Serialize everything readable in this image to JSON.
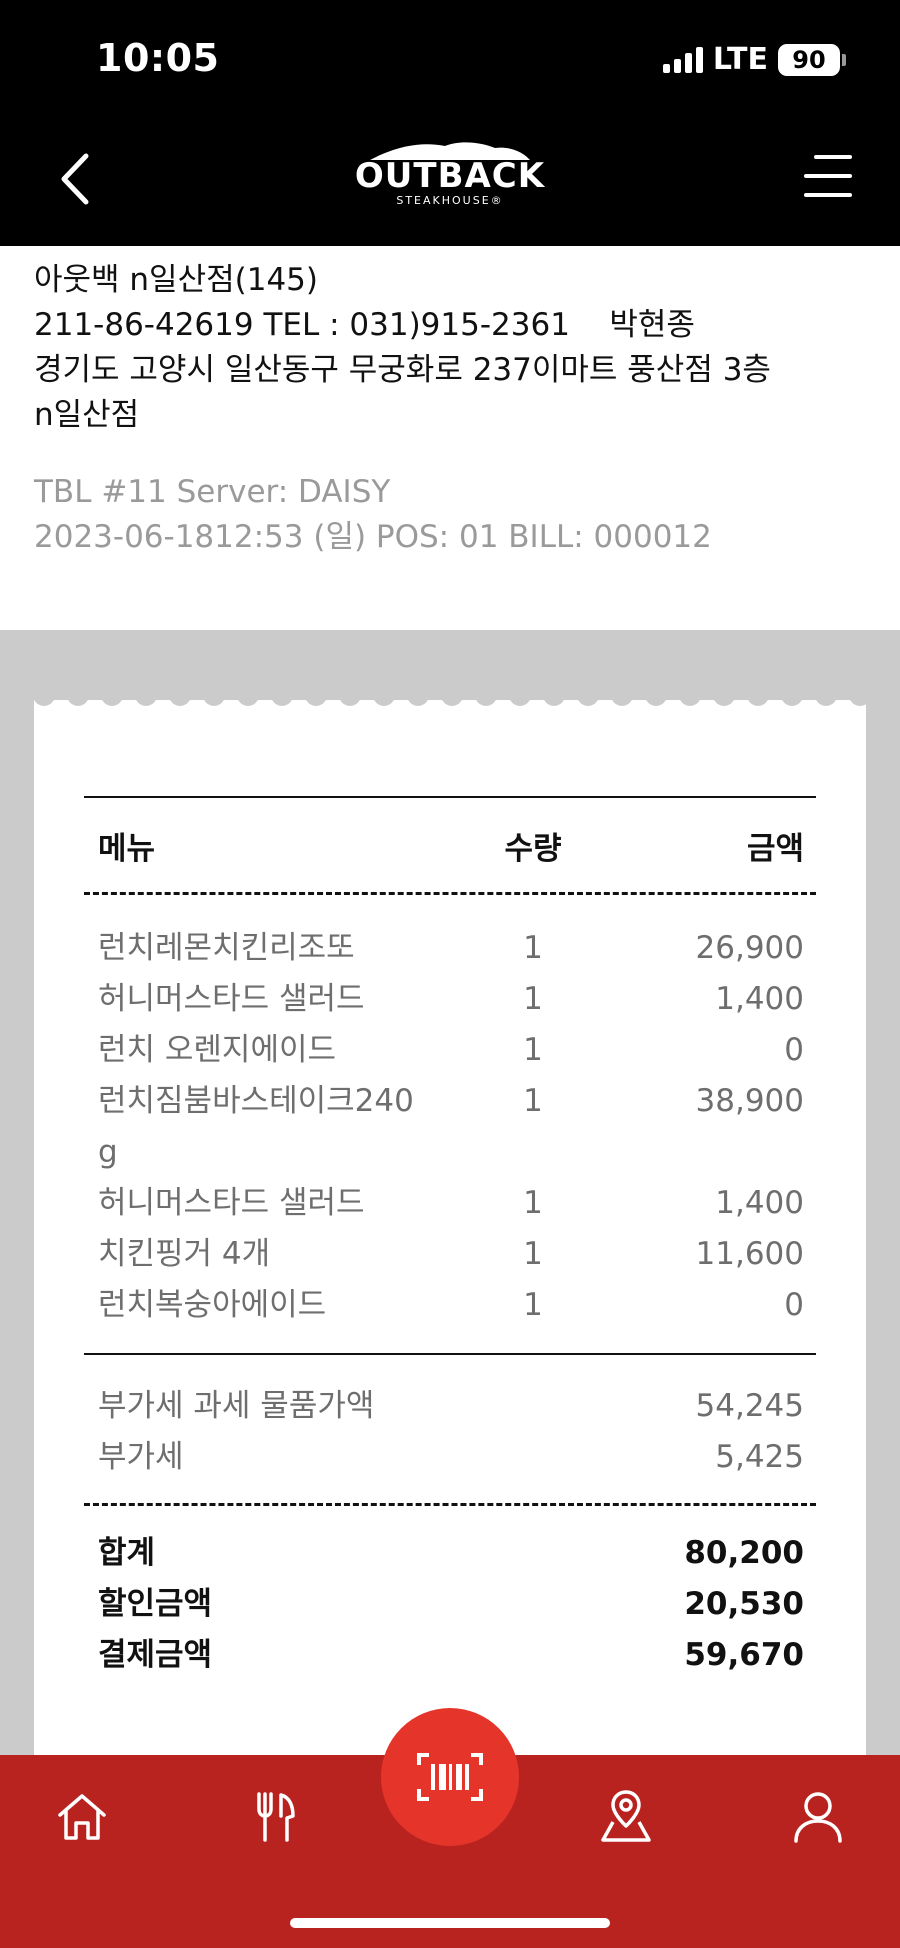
{
  "status_bar": {
    "time": "10:05",
    "network": "LTE",
    "battery": "90"
  },
  "header": {
    "logo_text": "OUTBACK",
    "logo_subtext": "STEAKHOUSE®",
    "back_icon": "chevron-left-icon",
    "menu_icon": "hamburger-menu-icon"
  },
  "store": {
    "name": "아웃백 n일산점(145)",
    "reg_line": "211-86-42619 TEL : 031)915-2361    박현종",
    "address_line1": "경기도 고양시 일산동구 무궁화로 237이마트 풍산점 3층",
    "address_line2": "n일산점"
  },
  "order_meta": {
    "table_line": "TBL #11 Server: DAISY",
    "datetime_line": "2023-06-1812:53 (일) POS: 01 BILL: 000012"
  },
  "receipt": {
    "columns": {
      "menu": "메뉴",
      "qty": "수량",
      "amount": "금액"
    },
    "items": [
      {
        "name": "런치레몬치킨리조또",
        "qty": "1",
        "amount": "26,900"
      },
      {
        "name": "허니머스타드 샐러드",
        "qty": "1",
        "amount": "1,400"
      },
      {
        "name": "런치 오렌지에이드",
        "qty": "1",
        "amount": "0"
      },
      {
        "name": "런치짐붐바스테이크240",
        "qty": "1",
        "amount": "38,900"
      },
      {
        "name": "g",
        "qty": "",
        "amount": ""
      },
      {
        "name": "허니머스타드 샐러드",
        "qty": "1",
        "amount": "1,400"
      },
      {
        "name": "치킨핑거 4개",
        "qty": "1",
        "amount": "11,600"
      },
      {
        "name": "런치복숭아에이드",
        "qty": "1",
        "amount": "0"
      }
    ],
    "tax": [
      {
        "label": "부가세 과세 물품가액",
        "value": "54,245"
      },
      {
        "label": "부가세",
        "value": "5,425"
      }
    ],
    "totals": [
      {
        "label": "합계",
        "value": "80,200"
      },
      {
        "label": "할인금액",
        "value": "20,530"
      },
      {
        "label": "결제금액",
        "value": "59,670"
      }
    ]
  },
  "tabbar": {
    "tabs": [
      "home-icon",
      "utensils-icon",
      "barcode-scan-icon",
      "location-pin-icon",
      "user-icon"
    ],
    "accent_color": "#b9231f",
    "scan_color": "#e5352b"
  }
}
